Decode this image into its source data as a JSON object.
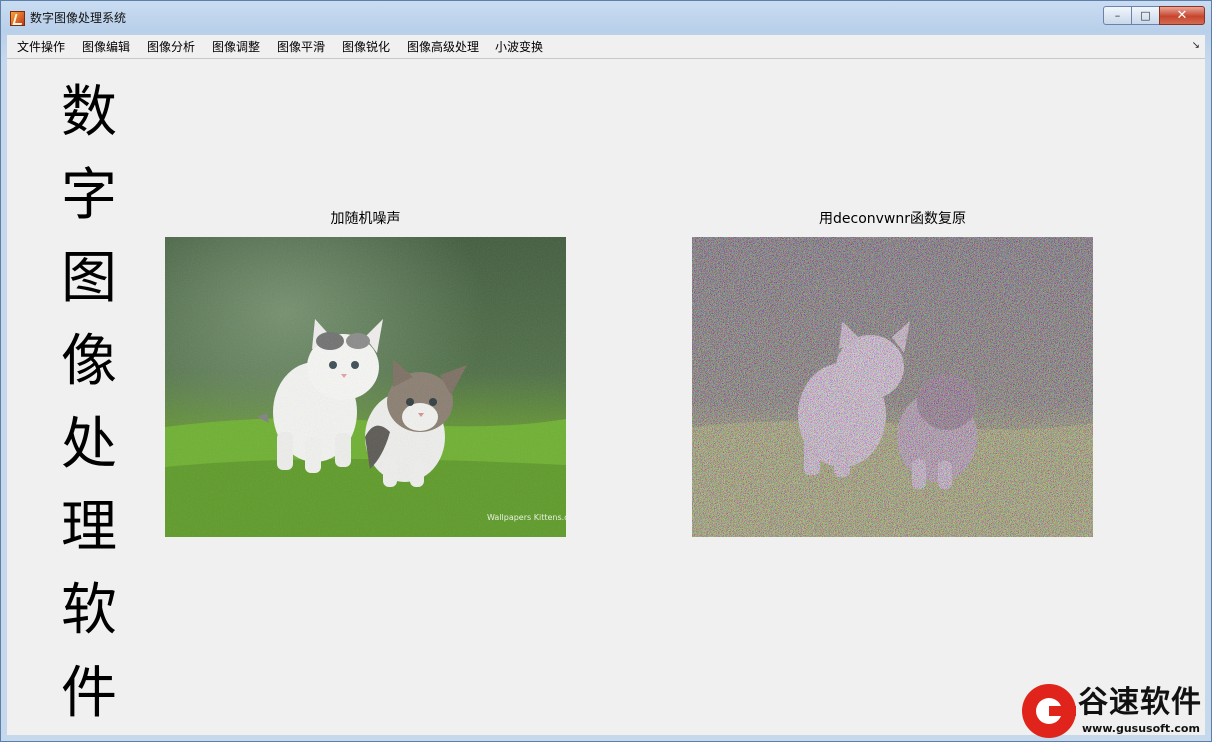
{
  "window": {
    "title": "数字图像处理系统",
    "controls": {
      "minimize": "–",
      "maximize": "□",
      "close": "✕"
    }
  },
  "menu": {
    "items": [
      "文件操作",
      "图像编辑",
      "图像分析",
      "图像调整",
      "图像平滑",
      "图像锐化",
      "图像高级处理",
      "小波变换"
    ],
    "overflow_icon": "chevron-icon"
  },
  "side_title": {
    "chars": [
      "数",
      "字",
      "图",
      "像",
      "处",
      "理",
      "软",
      "件"
    ]
  },
  "panels": {
    "left": {
      "title": "加随机噪声",
      "image": "kittens-on-grass-with-random-noise",
      "image_caption": "Wallpapers Kittens.com"
    },
    "right": {
      "title": "用deconvwnr函数复原",
      "image": "kittens-restored-with-heavy-color-noise"
    }
  },
  "watermark": {
    "brand": "谷速软件",
    "url": "www.gususoft.com"
  },
  "colors": {
    "window_frame": "#b9d0ea",
    "client_bg": "#f0f0f0",
    "close_button": "#c8452f",
    "brand_red": "#e0241b"
  }
}
